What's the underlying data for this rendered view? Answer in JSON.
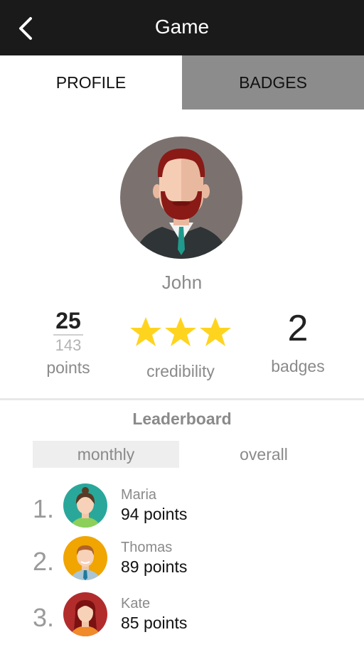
{
  "header": {
    "title": "Game",
    "back_icon": "chevron-left-icon"
  },
  "tabs": [
    {
      "label": "PROFILE",
      "active": true
    },
    {
      "label": "BADGES",
      "active": false
    }
  ],
  "profile": {
    "name": "John",
    "avatar_icon": "bearded-man-avatar",
    "points": {
      "current": "25",
      "total": "143",
      "label": "points"
    },
    "credibility": {
      "stars": 3,
      "label": "credibility"
    },
    "badges": {
      "count": "2",
      "label": "badges"
    }
  },
  "leaderboard": {
    "title": "Leaderboard",
    "periods": [
      {
        "label": "monthly",
        "selected": true
      },
      {
        "label": "overall",
        "selected": false
      }
    ],
    "entries": [
      {
        "rank": "1.",
        "name": "Maria",
        "points": "94 points",
        "avatar_color": "#2aa79b"
      },
      {
        "rank": "2.",
        "name": "Thomas",
        "points": "89 points",
        "avatar_color": "#f0a500"
      },
      {
        "rank": "3.",
        "name": "Kate",
        "points": "85 points",
        "avatar_color": "#b22c2c"
      }
    ]
  },
  "colors": {
    "topbar": "#1a1a1a",
    "inactive_tab": "#8c8c8c",
    "star": "#ffd41f"
  }
}
